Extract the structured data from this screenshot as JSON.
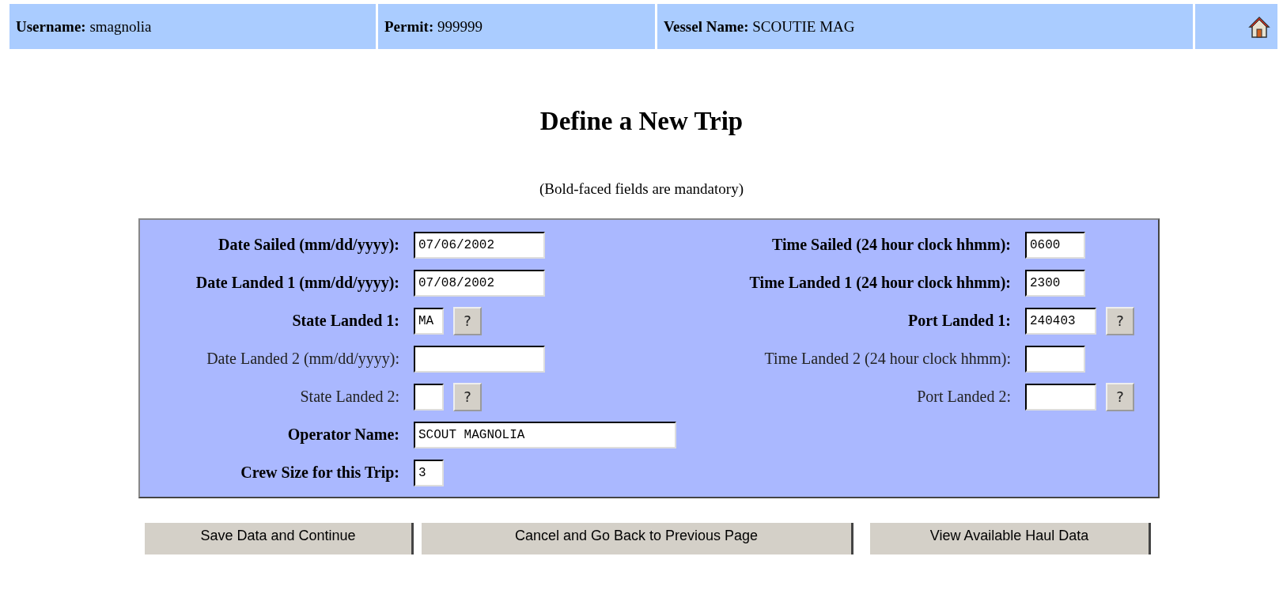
{
  "header": [
    {
      "label": "Username:",
      "value": "smagnolia"
    },
    {
      "label": "Permit:",
      "value": "999999"
    },
    {
      "label": "Vessel Name:",
      "value": "SCOUTIE MAG"
    }
  ],
  "title": "Define a New Trip",
  "note": "(Bold-faced fields are mandatory)",
  "form": {
    "rows": [
      {
        "left": {
          "label": "Date Sailed (mm/dd/yyyy):",
          "mandatory": true,
          "kind": "date",
          "value": "07/06/2002"
        },
        "right": {
          "label": "Time Sailed (24 hour clock hhmm):",
          "mandatory": true,
          "kind": "time",
          "value": "0600"
        }
      },
      {
        "left": {
          "label": "Date Landed 1 (mm/dd/yyyy):",
          "mandatory": true,
          "kind": "date",
          "value": "07/08/2002"
        },
        "right": {
          "label": "Time Landed 1 (24 hour clock hhmm):",
          "mandatory": true,
          "kind": "time",
          "value": "2300"
        }
      },
      {
        "left": {
          "label": "State Landed 1:",
          "mandatory": true,
          "kind": "state",
          "value": "MA",
          "help": "?"
        },
        "right": {
          "label": "Port Landed 1:",
          "mandatory": true,
          "kind": "port",
          "value": "240403",
          "help": "?"
        }
      },
      {
        "left": {
          "label": "Date Landed 2 (mm/dd/yyyy):",
          "mandatory": false,
          "kind": "date"
        },
        "right": {
          "label": "Time Landed 2 (24 hour clock hhmm):",
          "mandatory": false,
          "kind": "time"
        }
      },
      {
        "left": {
          "label": "State Landed 2:",
          "mandatory": false,
          "kind": "state",
          "help": "?"
        },
        "right": {
          "label": "Port Landed 2:",
          "mandatory": false,
          "kind": "port",
          "help": "?"
        }
      },
      {
        "left": {
          "label": "Operator Name:",
          "mandatory": true,
          "kind": "name",
          "value": "SCOUT MAGNOLIA"
        }
      },
      {
        "left": {
          "label": "Crew Size for this Trip:",
          "mandatory": true,
          "kind": "count",
          "value": "3"
        }
      }
    ]
  },
  "buttons": [
    "Save Data and Continue",
    "Cancel and Go Back to Previous Page",
    "View Available Haul Data"
  ]
}
